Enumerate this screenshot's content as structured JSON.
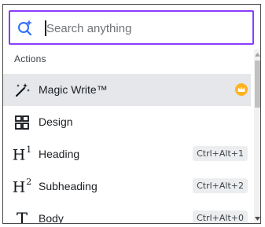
{
  "search": {
    "placeholder": "Search anything",
    "value": ""
  },
  "section": {
    "label": "Actions"
  },
  "items": [
    {
      "label": "Magic Write™",
      "icon": "magic-wand-icon",
      "badge": "crown-icon",
      "selected": true
    },
    {
      "label": "Design",
      "icon": "layout-grid-icon"
    },
    {
      "label": "Heading",
      "icon": "heading-1-icon",
      "glyph": "H",
      "sup": "1",
      "shortcut": "Ctrl+Alt+1"
    },
    {
      "label": "Subheading",
      "icon": "heading-2-icon",
      "glyph": "H",
      "sup": "2",
      "shortcut": "Ctrl+Alt+2"
    },
    {
      "label": "Body",
      "icon": "text-t-icon",
      "glyph": "T",
      "shortcut": "Ctrl+Alt+0"
    }
  ],
  "colors": {
    "accent": "#8b3dff",
    "selected_bg": "#e5e7ea",
    "badge": "#ffb31f"
  }
}
